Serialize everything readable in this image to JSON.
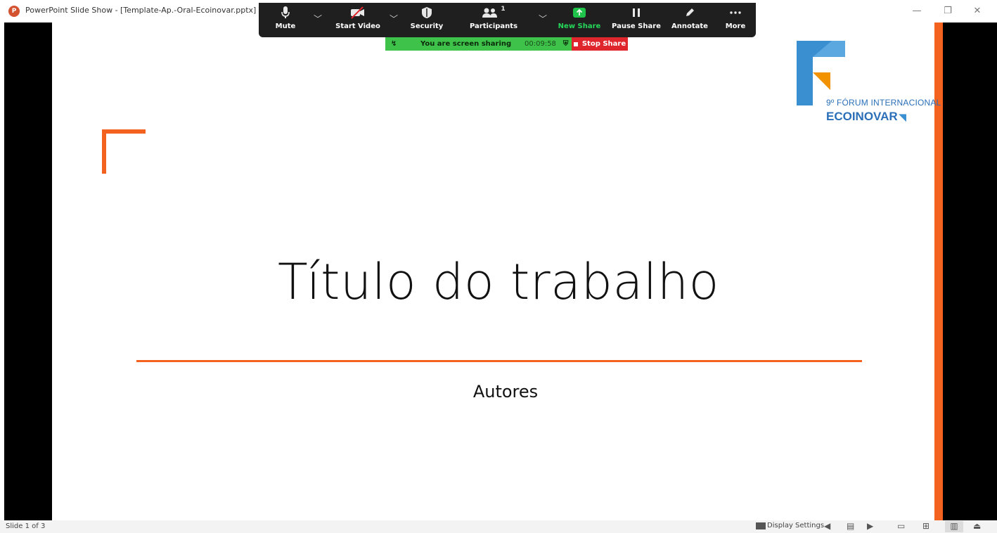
{
  "window": {
    "title": "PowerPoint Slide Show - [Template-Ap.-Oral-Ecoinovar.pptx] - PowerPoint",
    "app_icon_letter": "P",
    "minimize_glyph": "—",
    "restore_glyph": "❐",
    "close_glyph": "✕"
  },
  "zoom_toolbar": {
    "mute_label": "Mute",
    "start_video_label": "Start Video",
    "security_label": "Security",
    "participants_label": "Participants",
    "participants_count": "1",
    "new_share_label": "New Share",
    "pause_share_label": "Pause Share",
    "annotate_label": "Annotate",
    "more_label": "More",
    "icons": [
      "microphone-icon",
      "video-off-icon",
      "shield-icon",
      "participants-icon",
      "share-arrow-icon",
      "pause-icon",
      "pencil-icon",
      "ellipsis-icon"
    ],
    "accent_green": "#1fc24a"
  },
  "share_banner": {
    "message": "You are screen sharing",
    "elapsed": "00:09:58",
    "stop_label": "Stop Share",
    "banner_color": "#3ec24a",
    "stop_color": "#e0262d"
  },
  "slide": {
    "title": "Título do trabalho",
    "authors": "Autores",
    "accent_color": "#f4621f",
    "logo": {
      "line1": "9º FÓRUM INTERNACIONAL",
      "line2": "ECOINOVAR",
      "brand_blue": "#2a6fb8",
      "brand_orange": "#f39200"
    }
  },
  "status_bar": {
    "slide_counter": "Slide 1 of 3",
    "display_settings_label": "Display Settings"
  }
}
